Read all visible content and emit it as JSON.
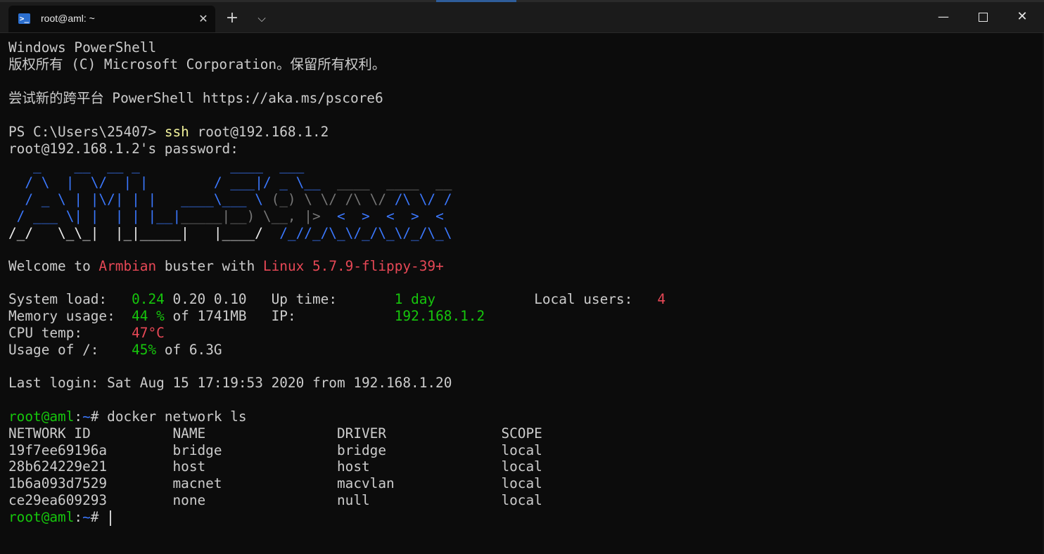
{
  "window": {
    "tab_title": "root@aml: ~",
    "tab_icon": "powershell-icon",
    "close_glyph": "✕",
    "new_tab_glyph": "+",
    "dropdown_glyph": "⌵",
    "minimize_glyph": "—",
    "close_window_glyph": "✕"
  },
  "terminal": {
    "intro": {
      "l1": "Windows PowerShell",
      "l2": "版权所有 (C) Microsoft Corporation。保留所有权利。",
      "l3": "尝试新的跨平台 PowerShell https://aka.ms/pscore6"
    },
    "ps_prompt": "PS C:\\Users\\25407> ",
    "ssh_cmd": "ssh",
    "ssh_args": " root@192.168.1.2",
    "password_prompt": "root@192.168.1.2's password:",
    "banner": {
      "r1a": "   _    __  __ _           ",
      "r1b": "____  ___",
      "r2a": "  / \\  |  \\/  | |        / ___|/ _ \\__  ",
      "r2b": "____  ____  __",
      "r3a": "  / _ \\ | |\\/| | |   ____\\___ \\ ",
      "r3b": "(_) \\ \\/ /\\ \\/ ",
      "r3c": "/\\ \\/ /",
      "r4a": " / ___ \\| |  | | |__|",
      "r4b": "_____|__) \\__, |> ",
      "r4c": " <  >  <  >  <",
      "r5a": "/_/   \\_\\_|  |_|_____|   |____/  ",
      "r5b": "/_//_/\\_\\/_/\\_\\/_/\\_\\"
    },
    "welcome": {
      "prefix": "Welcome to ",
      "distro": "Armbian",
      "mid": " buster with ",
      "kernel": "Linux 5.7.9-flippy-39+"
    },
    "stats": {
      "load_label": "System load:   ",
      "load_1": "0.24",
      "load_rest": " 0.20 0.10   ",
      "uptime_label": "Up time:       ",
      "uptime": "1 day",
      "users_pad": "            ",
      "users_label": "Local users:   ",
      "users": "4",
      "mem_label": "Memory usage:  ",
      "mem": "44 %",
      "mem_rest": " of 1741MB   ",
      "ip_label": "IP:            ",
      "ip": "192.168.1.2",
      "cpu_label": "CPU temp:      ",
      "cpu": "47°C",
      "usage_label": "Usage of /:    ",
      "usage": "45%",
      "usage_rest": " of 6.3G"
    },
    "last_login": "Last login: Sat Aug 15 17:19:53 2020 from 192.168.1.20",
    "prompt_user": "root@aml",
    "prompt_colon": ":",
    "prompt_path": "~",
    "prompt_hash": "# ",
    "command": "docker network ls",
    "table": {
      "header": "NETWORK ID          NAME                DRIVER              SCOPE",
      "rows": [
        "19f7ee69196a        bridge              bridge              local",
        "28b624229e21        host                host                local",
        "1b6a093d7529        macnet              macvlan             local",
        "ce29ea609293        none                null                local"
      ]
    }
  },
  "colors": {
    "background": "#0c0c0c",
    "prompt_green": "#16c60c",
    "accent_red": "#e74856",
    "banner_blue": "#3b78ff",
    "command_yellow": "#f1f19a"
  }
}
